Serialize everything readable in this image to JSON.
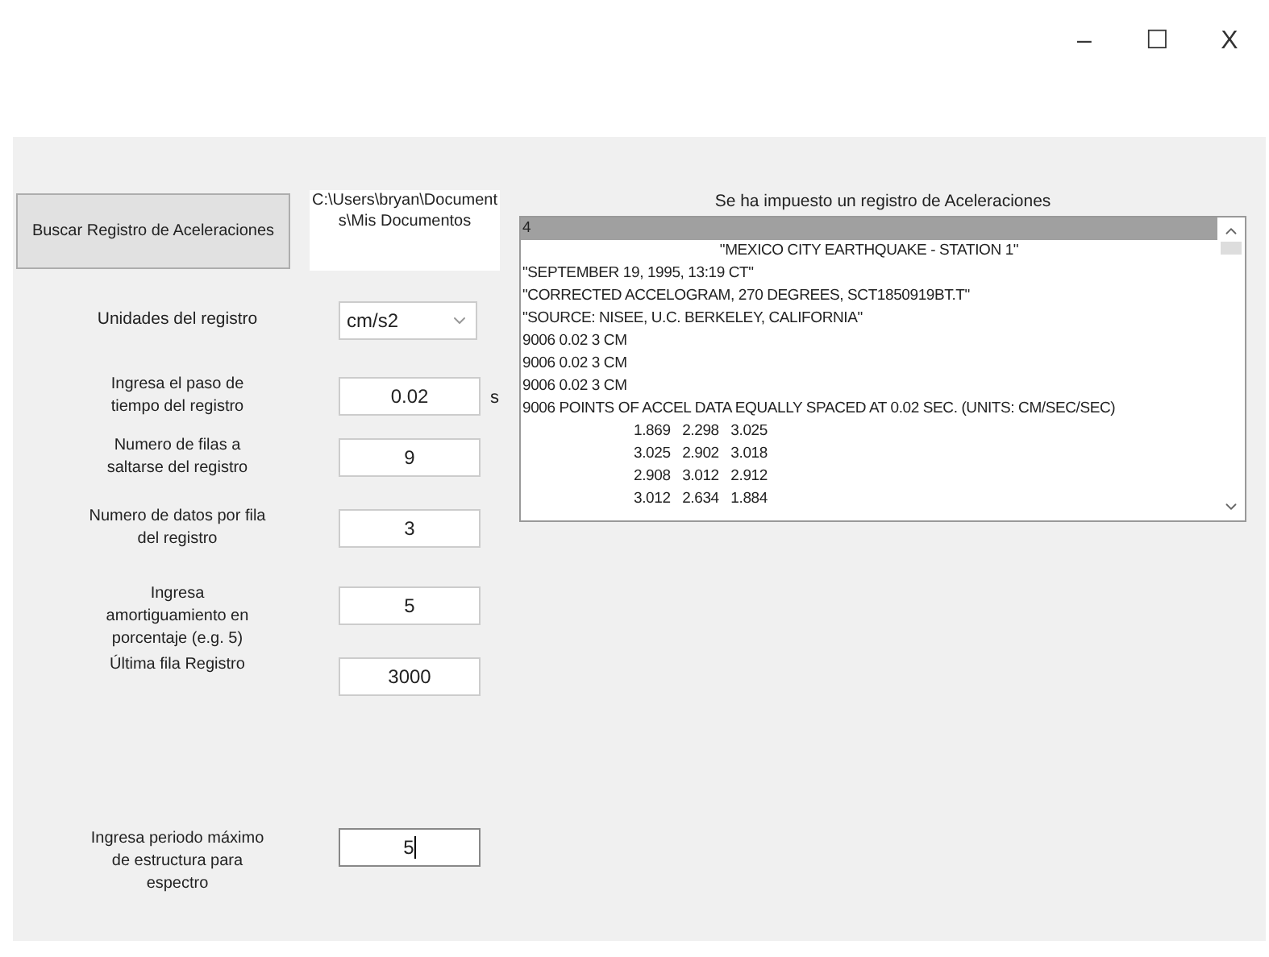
{
  "window": {
    "controls": [
      "–",
      "☐",
      "X"
    ]
  },
  "load_button": {
    "label": "Buscar Registro de Aceleraciones"
  },
  "file_path": [
    "C:\\Users\\bryan\\Document",
    "s\\Mis Documentos"
  ],
  "units": {
    "label": "Unidades del registro",
    "value": "cm/s2"
  },
  "fields": [
    {
      "label": "Ingresa el paso de tiempo del registro",
      "value": "0.02",
      "unit": "s",
      "focused": false
    },
    {
      "label": "Numero de filas a saltarse del registro",
      "value": "9",
      "focused": false
    },
    {
      "label": "Numero de datos por fila del registro",
      "value": "3",
      "focused": false
    },
    {
      "label": "Ingresa amortiguamiento en porcentaje (e.g. 5)",
      "value": "5",
      "focused": false
    },
    {
      "label": "Última fila Registro",
      "value": "3000",
      "focused": false
    },
    {
      "label": "Ingresa periodo máximo de estructura para espectro",
      "value": "5",
      "focused": true
    }
  ],
  "record": {
    "title": "Se ha impuesto un registro de Aceleraciones",
    "lines": [
      {
        "text": "4",
        "kind": "plain",
        "selected": true
      },
      {
        "text": "\"MEXICO CITY EARTHQUAKE - STATION 1\"",
        "kind": "centered",
        "selected": false
      },
      {
        "text": "\"SEPTEMBER 19, 1995, 13:19 CT\"",
        "kind": "plain",
        "selected": false
      },
      {
        "text": "\"CORRECTED ACCELOGRAM, 270 DEGREES, SCT1850919BT.T\"",
        "kind": "plain",
        "selected": false
      },
      {
        "text": "\"SOURCE: NISEE, U.C. BERKELEY, CALIFORNIA\"",
        "kind": "plain",
        "selected": false
      },
      {
        "text": "9006 0.02 3 CM",
        "kind": "plain",
        "selected": false
      },
      {
        "text": "9006 0.02 3 CM",
        "kind": "plain",
        "selected": false
      },
      {
        "text": "9006 0.02 3 CM",
        "kind": "plain",
        "selected": false
      },
      {
        "text": "9006 POINTS OF ACCEL DATA EQUALLY SPACED AT 0.02 SEC. (UNITS: CM/SEC/SEC)",
        "kind": "plain",
        "selected": false
      },
      {
        "text": "1.869   2.298   3.025",
        "kind": "indented",
        "selected": false
      },
      {
        "text": "3.025   2.902   3.018",
        "kind": "indented",
        "selected": false
      },
      {
        "text": "2.908   3.012   2.912",
        "kind": "indented",
        "selected": false
      },
      {
        "text": "3.012   2.634   1.884",
        "kind": "indented",
        "selected": false
      }
    ]
  }
}
